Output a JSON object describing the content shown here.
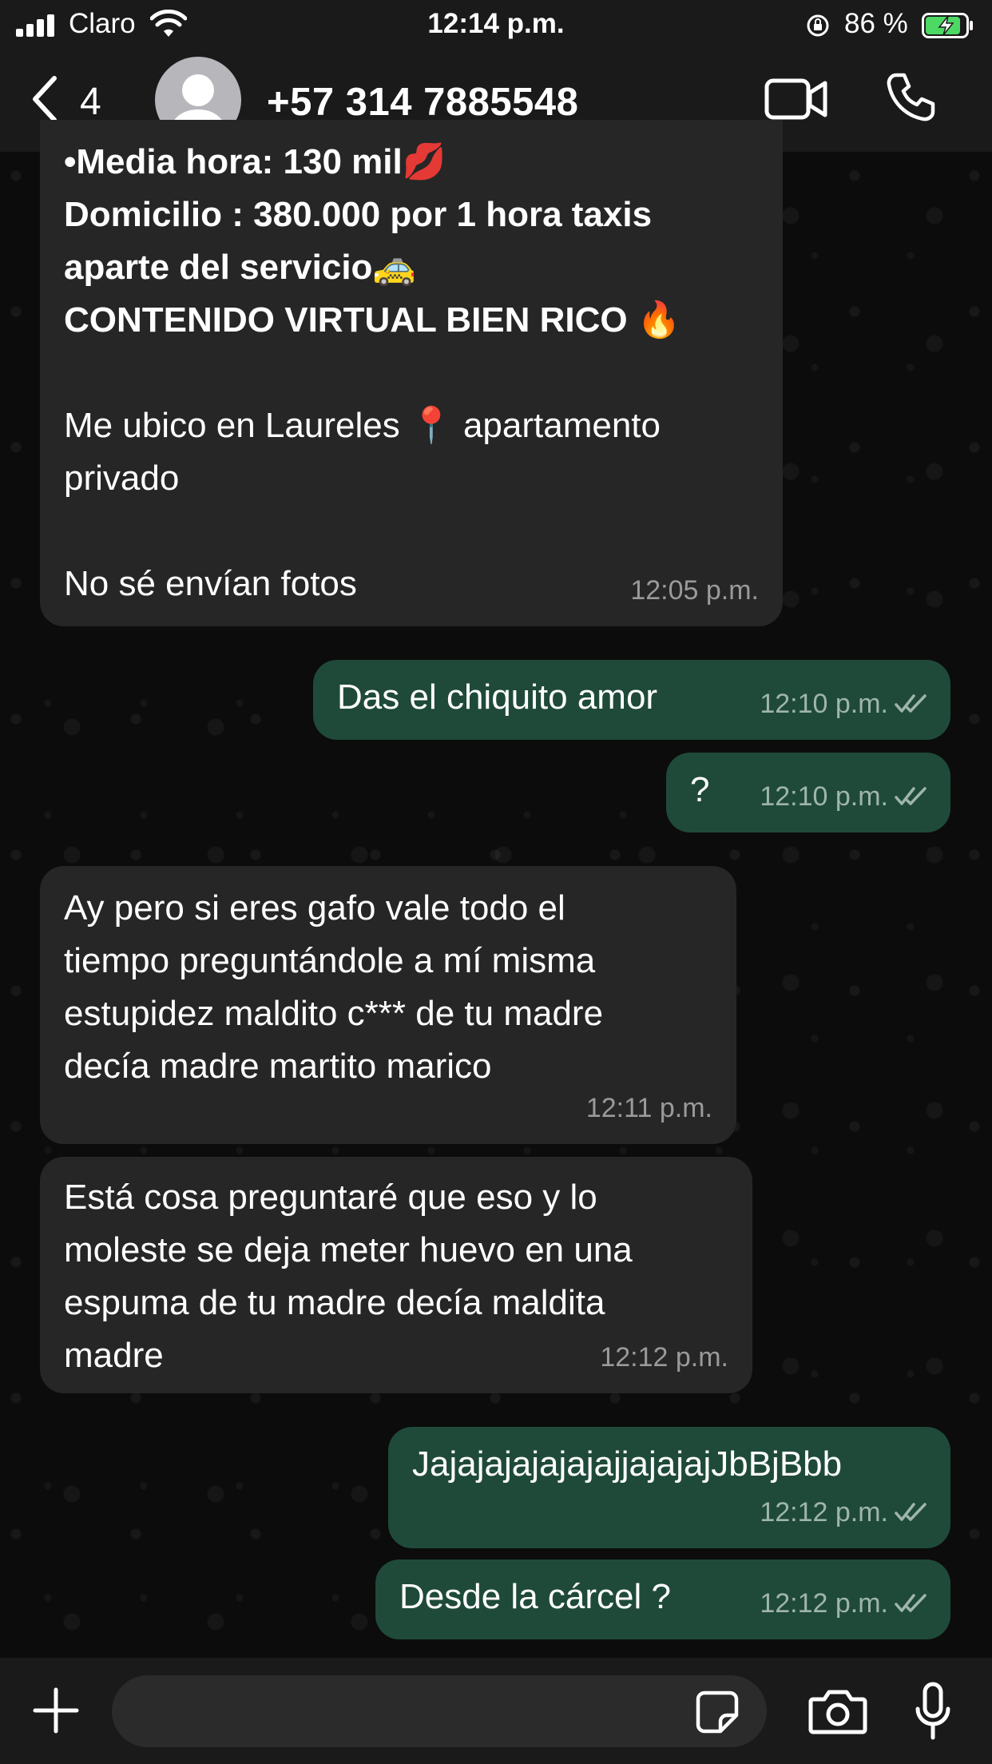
{
  "status_bar": {
    "carrier": "Claro",
    "time": "12:14 p.m.",
    "battery": "86 %"
  },
  "header": {
    "back_count": "4",
    "contact": "+57 314 7885548"
  },
  "messages": [
    {
      "direction": "incoming",
      "lines": "•Media hora: 130 mil💋\nDomicilio : 380.000 por 1 hora taxis\naparte del servicio🚕\nCONTENIDO VIRTUAL BIEN RICO 🔥",
      "body": "Me ubico en Laureles 📍 apartamento\nprivado\n\nNo sé envían fotos",
      "time": "12:05 p.m."
    },
    {
      "direction": "outgoing",
      "text": "Das el chiquito amor",
      "time": "12:10 p.m."
    },
    {
      "direction": "outgoing",
      "text": "?",
      "time": "12:10 p.m."
    },
    {
      "direction": "incoming",
      "text": "Ay pero si eres gafo vale todo el\ntiempo preguntándole a mí misma\nestupidez maldito c*** de tu madre\ndecía madre martito marico",
      "time": "12:11 p.m."
    },
    {
      "direction": "incoming",
      "text": "Está cosa preguntaré que eso y lo\nmoleste se deja meter huevo en una\nespuma de tu madre decía maldita\nmadre",
      "time": "12:12 p.m."
    },
    {
      "direction": "outgoing",
      "text": "JajajajajajajajjajajajJbBjBbb",
      "time": "12:12 p.m."
    },
    {
      "direction": "outgoing",
      "text": "Desde la cárcel ?",
      "time": "12:12 p.m."
    }
  ],
  "composer": {
    "placeholder": ""
  },
  "colors": {
    "incoming_bubble": "#262626",
    "outgoing_bubble": "#1f4a3a",
    "bar_background": "#1a1a1a"
  },
  "icons": [
    "signal-icon",
    "wifi-icon",
    "rotation-lock-icon",
    "battery-charging-icon",
    "back-chevron-icon",
    "avatar-placeholder-icon",
    "video-call-icon",
    "phone-call-icon",
    "plus-icon",
    "sticker-icon",
    "camera-icon",
    "microphone-icon",
    "read-ticks-icon"
  ]
}
